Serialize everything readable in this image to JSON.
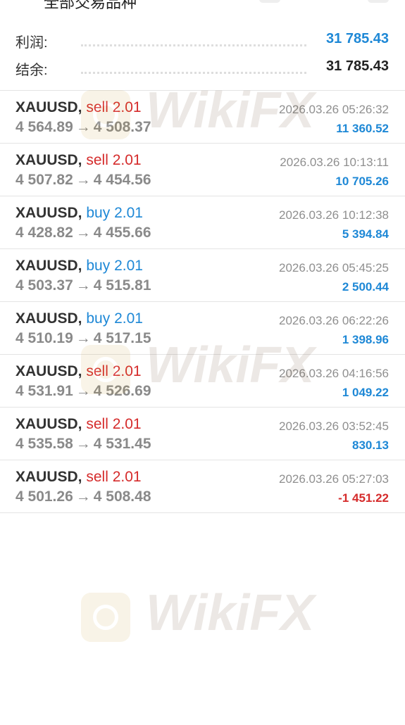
{
  "header": {
    "title": "全部交易品种"
  },
  "summary": {
    "profit": {
      "label": "利润:",
      "value": "31 785.43",
      "color": "#1e88d6"
    },
    "balance": {
      "label": "结余:",
      "value": "31 785.43",
      "color": "#222222"
    }
  },
  "trades": [
    {
      "symbol": "XAUUSD,",
      "side": "sell",
      "volume": "2.01",
      "open_price": "4 564.89",
      "arrow": "→",
      "close_price": "4 508.37",
      "time": "2026.03.26 05:26:32",
      "profit": "11 360.52",
      "profit_sign": "positive"
    },
    {
      "symbol": "XAUUSD,",
      "side": "sell",
      "volume": "2.01",
      "open_price": "4 507.82",
      "arrow": "→",
      "close_price": "4 454.56",
      "time": "2026.03.26 10:13:11",
      "profit": "10 705.26",
      "profit_sign": "positive"
    },
    {
      "symbol": "XAUUSD,",
      "side": "buy",
      "volume": "2.01",
      "open_price": "4 428.82",
      "arrow": "→",
      "close_price": "4 455.66",
      "time": "2026.03.26 10:12:38",
      "profit": "5 394.84",
      "profit_sign": "positive"
    },
    {
      "symbol": "XAUUSD,",
      "side": "buy",
      "volume": "2.01",
      "open_price": "4 503.37",
      "arrow": "→",
      "close_price": "4 515.81",
      "time": "2026.03.26 05:45:25",
      "profit": "2 500.44",
      "profit_sign": "positive"
    },
    {
      "symbol": "XAUUSD,",
      "side": "buy",
      "volume": "2.01",
      "open_price": "4 510.19",
      "arrow": "→",
      "close_price": "4 517.15",
      "time": "2026.03.26 06:22:26",
      "profit": "1 398.96",
      "profit_sign": "positive"
    },
    {
      "symbol": "XAUUSD,",
      "side": "sell",
      "volume": "2.01",
      "open_price": "4 531.91",
      "arrow": "→",
      "close_price": "4 526.69",
      "time": "2026.03.26 04:16:56",
      "profit": "1 049.22",
      "profit_sign": "positive"
    },
    {
      "symbol": "XAUUSD,",
      "side": "sell",
      "volume": "2.01",
      "open_price": "4 535.58",
      "arrow": "→",
      "close_price": "4 531.45",
      "time": "2026.03.26 03:52:45",
      "profit": "830.13",
      "profit_sign": "positive"
    },
    {
      "symbol": "XAUUSD,",
      "side": "sell",
      "volume": "2.01",
      "open_price": "4 501.26",
      "arrow": "→",
      "close_price": "4 508.48",
      "time": "2026.03.26 05:27:03",
      "profit": "-1 451.22",
      "profit_sign": "negative"
    }
  ],
  "watermark": {
    "text": "WikiFX",
    "icon": "wikifx-logo-icon"
  }
}
